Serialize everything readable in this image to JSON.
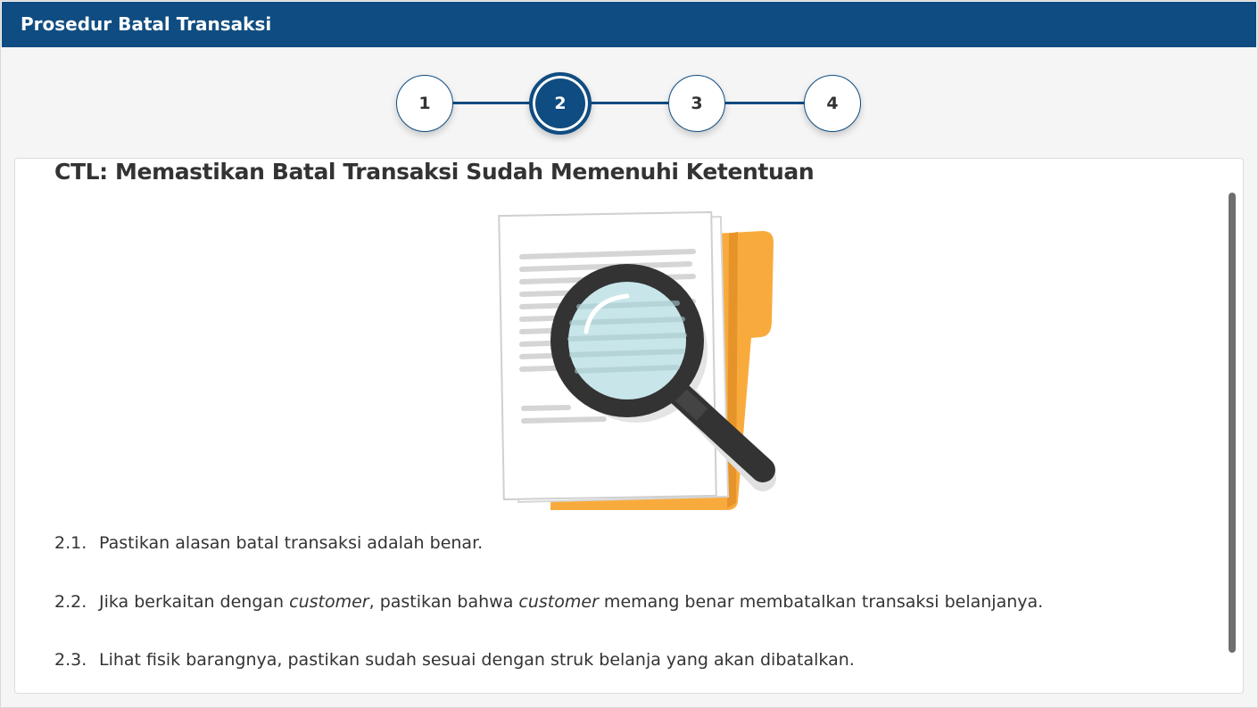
{
  "window": {
    "title": "Prosedur Batal Transaksi"
  },
  "stepper": {
    "steps": [
      {
        "label": "1",
        "active": false
      },
      {
        "label": "2",
        "active": true
      },
      {
        "label": "3",
        "active": false
      },
      {
        "label": "4",
        "active": false
      }
    ],
    "accent_color": "#0f4c81"
  },
  "content": {
    "title": "CTL: Memastikan Batal Transaksi Sudah Memenuhi Ketentuan",
    "illustration_icon": "document-magnifier-icon",
    "items": [
      {
        "number": "2.1.",
        "text": "Pastikan alasan batal transaksi adalah benar."
      },
      {
        "number": "2.2.",
        "text_part1": "Jika berkaitan dengan ",
        "italic1": "customer",
        "text_part2": ", pastikan bahwa ",
        "italic2": "customer",
        "text_part3": " memang benar membatalkan transaksi belanjanya."
      },
      {
        "number": "2.3.",
        "text": "Lihat fisik barangnya, pastikan sudah sesuai dengan struk belanja yang akan dibatalkan."
      }
    ]
  },
  "colors": {
    "header_bg": "#0f4c81",
    "folder": "#f8ab3c",
    "lens": "#c8e6ea",
    "handle": "#333333"
  }
}
